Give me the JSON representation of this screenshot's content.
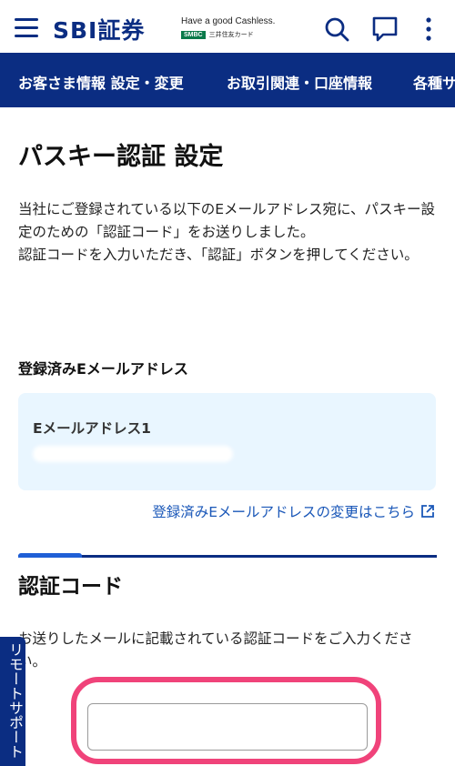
{
  "header": {
    "brand": "SBI証券",
    "tagline": "Have a good Cashless.",
    "partner_badge": "SMBC",
    "partner_name": "三井住友カード",
    "icons": [
      "menu-icon",
      "search-icon",
      "chat-icon",
      "more-vertical-icon"
    ]
  },
  "nav": {
    "items": [
      "お客さま情報 設定・変更",
      "お取引関連・口座情報",
      "各種サ"
    ]
  },
  "page": {
    "title": "パスキー認証 設定",
    "description": [
      "当社にご登録されている以下のEメールアドレス宛に、パスキー設定のための「認証コード」をお送りしました。",
      "認証コードを入力いただき、「認証」ボタンを押してください。"
    ],
    "registered_email_label": "登録済みEメールアドレス",
    "email_card_label": "Eメールアドレス1",
    "change_link": "登録済みEメールアドレスの変更はこちら"
  },
  "verification": {
    "title": "認証コード",
    "instruction": "お送りしたメールに記載されている認証コードをご入力ください。",
    "input_value": "",
    "input_placeholder": ""
  },
  "remote_support": {
    "label": "リモートサポート"
  },
  "colors": {
    "brand_navy": "#0b2d82",
    "link_blue": "#1a57b8",
    "card_bg": "#e9f6ff",
    "highlight_pink": "#f0437a"
  }
}
